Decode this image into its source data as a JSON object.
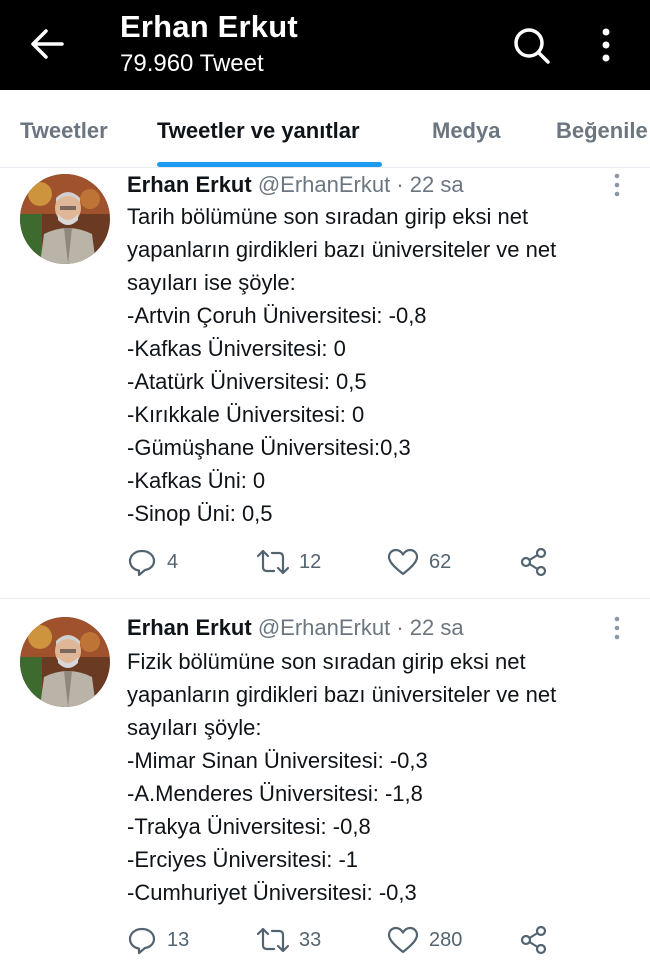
{
  "header": {
    "title": "Erhan Erkut",
    "subtitle": "79.960 Tweet",
    "back_icon": "arrow-left-icon",
    "search_icon": "search-icon",
    "more_icon": "more-vertical-icon"
  },
  "tabs": [
    {
      "label": "Tweetler",
      "active": false
    },
    {
      "label": "Tweetler ve yanıtlar",
      "active": true
    },
    {
      "label": "Medya",
      "active": false
    },
    {
      "label": "Beğenile",
      "active": false
    }
  ],
  "colors": {
    "accent": "#1d9bf0",
    "header_bg": "#000000",
    "muted": "#6b7680"
  },
  "tweets": [
    {
      "name": "Erhan Erkut",
      "handle": "@ErhanErkut",
      "separator": "·",
      "time": "22 sa",
      "lines": [
        "Tarih bölümüne son sıradan girip eksi net",
        "yapanların girdikleri bazı üniversiteler ve net",
        "sayıları ise şöyle:",
        "-Artvin Çoruh Üniversitesi: -0,8",
        "-Kafkas Üniversitesi: 0",
        "-Atatürk Üniversitesi: 0,5",
        "-Kırıkkale Üniversitesi: 0",
        "-Gümüşhane Üniversitesi:0,3",
        "-Kafkas Üni: 0",
        "-Sinop Üni: 0,5"
      ],
      "replies": "4",
      "retweets": "12",
      "likes": "62"
    },
    {
      "name": "Erhan Erkut",
      "handle": "@ErhanErkut",
      "separator": "·",
      "time": "22 sa",
      "lines": [
        "Fizik bölümüne son sıradan girip eksi net",
        "yapanların girdikleri bazı üniversiteler ve net",
        "sayıları şöyle:",
        "-Mimar Sinan Üniversitesi: -0,3",
        "-A.Menderes Üniversitesi: -1,8",
        "-Trakya Üniversitesi: -0,8",
        "-Erciyes Üniversitesi: -1",
        "-Cumhuriyet Üniversitesi: -0,3"
      ],
      "replies": "13",
      "retweets": "33",
      "likes": "280"
    }
  ]
}
